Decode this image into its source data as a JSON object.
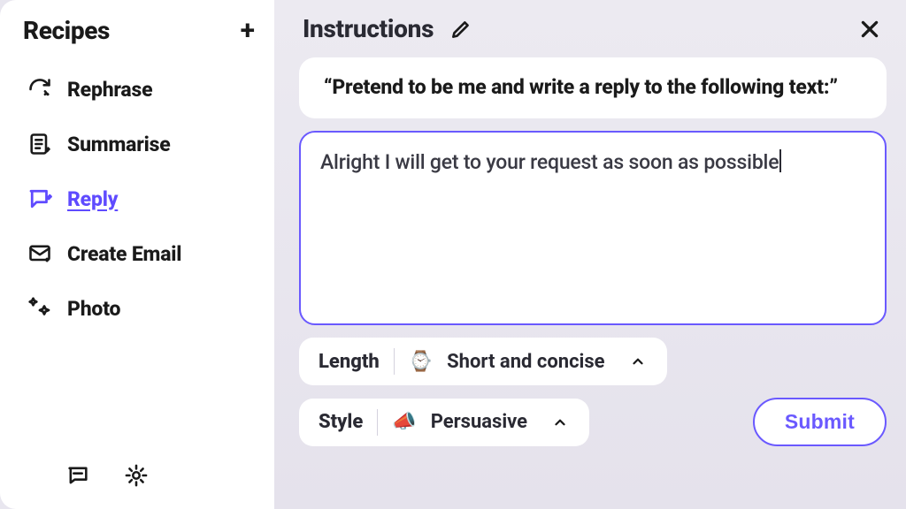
{
  "sidebar": {
    "title": "Recipes",
    "items": [
      {
        "label": "Rephrase"
      },
      {
        "label": "Summarise"
      },
      {
        "label": "Reply"
      },
      {
        "label": "Create Email"
      },
      {
        "label": "Photo"
      }
    ]
  },
  "main": {
    "title": "Instructions",
    "prompt": "“Pretend to be me and write a reply to the following text:”",
    "input_value": "Alright I will get to your request as soon as possible",
    "length": {
      "label": "Length",
      "value": "Short and concise",
      "emoji": "⌚"
    },
    "style": {
      "label": "Style",
      "value": "Persuasive",
      "emoji": "📣"
    },
    "submit_label": "Submit"
  },
  "colors": {
    "accent": "#6a59ff"
  }
}
